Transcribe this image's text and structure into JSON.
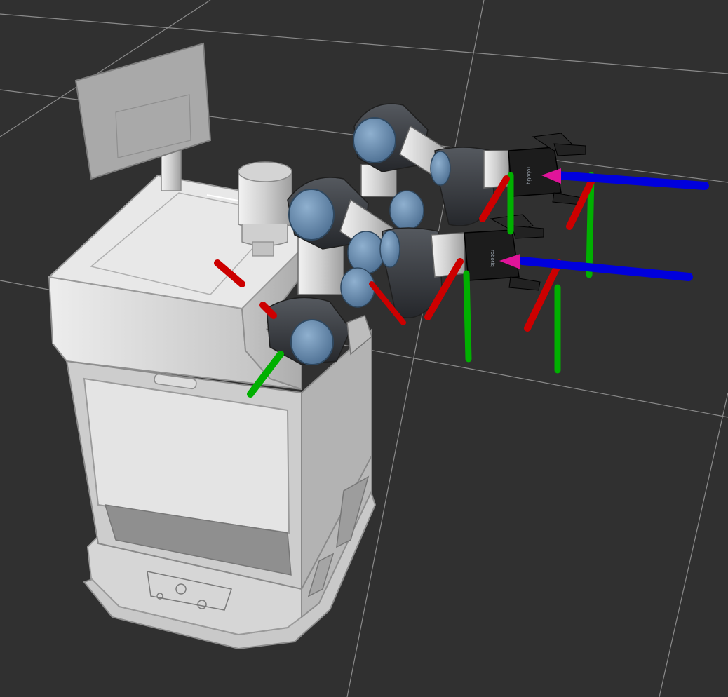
{
  "scene": {
    "background": "#303030",
    "grid_color": "#8a8a8a",
    "robot_body_color": "#d9d9d9",
    "joint_cap_color": "#6b8aa8",
    "joint_dark_color": "#3a3d42",
    "axis_colors": {
      "x": "#cc0000",
      "y": "#00b000",
      "z": "#0000dd"
    },
    "tcp_marker_color": "#e0149a"
  },
  "grippers": {
    "upper": {
      "logo_text": "robotiq",
      "icon": "robotiq-gripper-icon"
    },
    "lower": {
      "logo_text": "robotiq",
      "icon": "robotiq-gripper-icon"
    }
  }
}
